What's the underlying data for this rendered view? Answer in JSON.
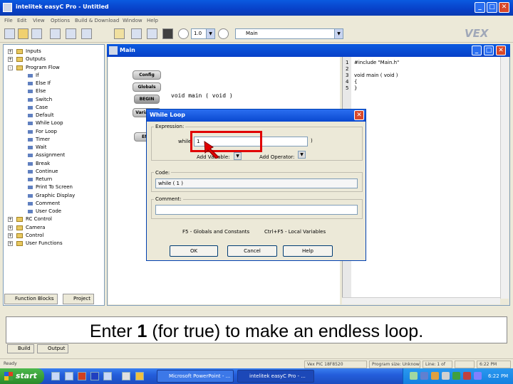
{
  "window": {
    "title": "intelitek easyC Pro - Untitled",
    "min": "_",
    "max": "□",
    "close": "✕"
  },
  "menu": [
    "File",
    "Edit",
    "View",
    "Options",
    "Build & Download",
    "Window",
    "Help"
  ],
  "toolbar": {
    "zoom_value": "1.0",
    "function_select": "Main",
    "logo": "VEX"
  },
  "tree": [
    {
      "label": "Inputs",
      "type": "root",
      "exp": "+"
    },
    {
      "label": "Outputs",
      "type": "root",
      "exp": "+"
    },
    {
      "label": "Program Flow",
      "type": "root",
      "exp": "-"
    },
    {
      "label": "If",
      "type": "leaf"
    },
    {
      "label": "Else If",
      "type": "leaf"
    },
    {
      "label": "Else",
      "type": "leaf"
    },
    {
      "label": "Switch",
      "type": "leaf"
    },
    {
      "label": "Case",
      "type": "leaf"
    },
    {
      "label": "Default",
      "type": "leaf"
    },
    {
      "label": "While Loop",
      "type": "leaf"
    },
    {
      "label": "For Loop",
      "type": "leaf"
    },
    {
      "label": "Timer",
      "type": "leaf"
    },
    {
      "label": "Wait",
      "type": "leaf"
    },
    {
      "label": "Assignment",
      "type": "leaf"
    },
    {
      "label": "Break",
      "type": "leaf"
    },
    {
      "label": "Continue",
      "type": "leaf"
    },
    {
      "label": "Return",
      "type": "leaf"
    },
    {
      "label": "Print To Screen",
      "type": "leaf"
    },
    {
      "label": "Graphic Display",
      "type": "leaf"
    },
    {
      "label": "Comment",
      "type": "leaf"
    },
    {
      "label": "User Code",
      "type": "leaf"
    },
    {
      "label": "RC Control",
      "type": "root",
      "exp": "+"
    },
    {
      "label": "Camera",
      "type": "root",
      "exp": "+"
    },
    {
      "label": "Control",
      "type": "root",
      "exp": "+"
    },
    {
      "label": "User Functions",
      "type": "root",
      "exp": "+"
    }
  ],
  "panel_tabs": {
    "function_blocks": "Function Blocks",
    "project": "Project"
  },
  "child_window": {
    "title": "Main"
  },
  "flow": {
    "config": "Config",
    "globals": "Globals",
    "begin": "BEGIN",
    "variables": "Variables",
    "end": "END",
    "void_main": "void main ( void )"
  },
  "code_lines": [
    {
      "num": "1",
      "text": "#include \"Main.h\""
    },
    {
      "num": "2",
      "text": ""
    },
    {
      "num": "3",
      "text": "void main ( void )"
    },
    {
      "num": "4",
      "text": "{"
    },
    {
      "num": "5",
      "text": "}"
    }
  ],
  "dialog": {
    "title": "While Loop",
    "close": "✕",
    "expression_label": "Expression:",
    "while_label": "while",
    "expression_value": "1",
    "add_variable": "Add Variable:",
    "add_operator": "Add Operator:",
    "code_label": "Code:",
    "code_value": "while ( 1 )",
    "comment_label": "Comment:",
    "comment_value": "",
    "hint_globals": "F5 - Globals and Constants",
    "hint_locals": "Ctrl+F5 - Local Variables",
    "ok": "OK",
    "cancel": "Cancel",
    "help": "Help"
  },
  "caption": {
    "before": "Enter ",
    "bold": "1",
    "after": " (for true) to make an endless loop."
  },
  "output_tabs": {
    "build": "Build",
    "output": "Output"
  },
  "status": {
    "ready": "Ready",
    "device": "Vex PIC 18F8520",
    "program_size": "Program size: Unknown",
    "line": "Line: 1  of",
    "time": "6:22 PM"
  },
  "taskbar": {
    "start": "start",
    "task1": "Microsoft PowerPoint - ...",
    "task2": "intelitek easyC Pro - ...",
    "clock": "6:22 PM"
  }
}
